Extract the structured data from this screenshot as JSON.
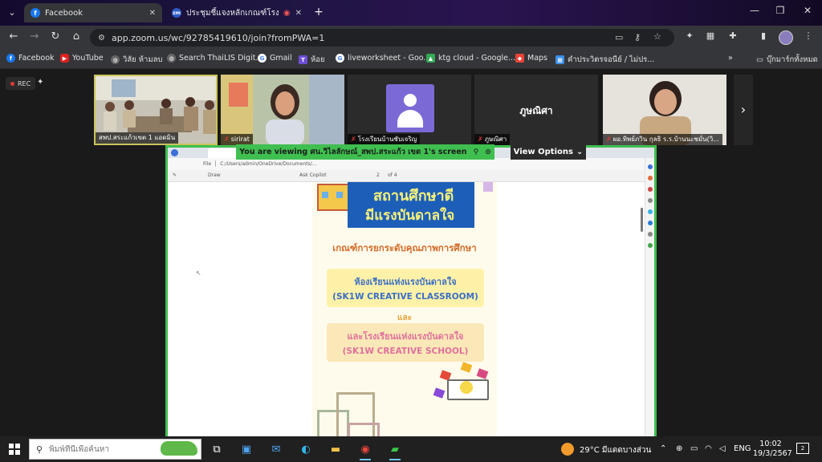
{
  "browser": {
    "tabs": [
      {
        "title": "Facebook",
        "active": true
      },
      {
        "title": "ประชุมชี้แจงหลักเกณฑ์โรงเรียนแ",
        "active": false
      }
    ],
    "url": "app.zoom.us/wc/92785419610/join?fromPWA=1",
    "bookmarks": [
      "Facebook",
      "YouTube",
      "วิลัย ห้ามลบ",
      "Search ThaiLIS Digit...",
      "Gmail",
      "ห้อย",
      "liveworksheet - Goo...",
      "ktg cloud - Google...",
      "Maps",
      "คำประวิตรจอนีย์ / ไม่ปร..."
    ],
    "bookmarks_folder": "บุ๊กมาร์กทั้งหมด",
    "overflow": "»"
  },
  "zoom": {
    "rec_label": "REC",
    "participants": [
      {
        "name": "สพป.สระแก้วเขต 1 แอดมิน",
        "muted": false
      },
      {
        "name": "sirirat",
        "muted": true
      },
      {
        "name": "โรงเรียนบ้านชับเจริญ",
        "muted": true
      },
      {
        "name": "ภูษณิศา",
        "muted": true,
        "display_text": "ภูษณิศา"
      },
      {
        "name": "ผอ.ทิพย์ภวิน กุลธิ ร.ร.บ้านนะชมั่น(วิ...",
        "muted": true
      }
    ],
    "share_banner": "You are viewing  ศน.วิไลลักษณ์_สพป.สระแก้ว เขต 1's screen",
    "view_options": "View Options"
  },
  "shared_screen": {
    "address_path": "C:/Users/admin/OneDrive/Documents/...",
    "file_label": "File",
    "pdf_toolbar": {
      "draw": "Draw",
      "page": "2",
      "of": "of 4",
      "ask": "Ask Copilot"
    },
    "doc": {
      "banner_line1": "สถานศึกษาดี",
      "banner_line2": "มีแรงบันดาลใจ",
      "heading": "เกณฑ์การยกระดับคุณภาพการศึกษา",
      "box1_line1": "ห้องเรียนแห่งแรงบันดาลใจ",
      "box1_line2": "(SK1W CREATIVE CLASSROOM)",
      "and": "และ",
      "box2_line1": "และโรงเรียนแห่งแรงบันดาลใจ",
      "box2_line2": "(SK1W CREATIVE SCHOOL)"
    }
  },
  "taskbar": {
    "search_placeholder": "พิมพ์ที่นี่เพื่อค้นหา",
    "weather": "29°C  มีแดดบางส่วน",
    "lang": "ENG",
    "time": "10:02",
    "date": "19/3/2567",
    "notifications": "2"
  },
  "colors": {
    "zoom_share_green": "#3fbf4f",
    "doc_blue": "#1d5fb8",
    "doc_orange": "#d46c2a",
    "box1_blue_text": "#3a6fc4",
    "box2_pink_text": "#e0709b"
  }
}
